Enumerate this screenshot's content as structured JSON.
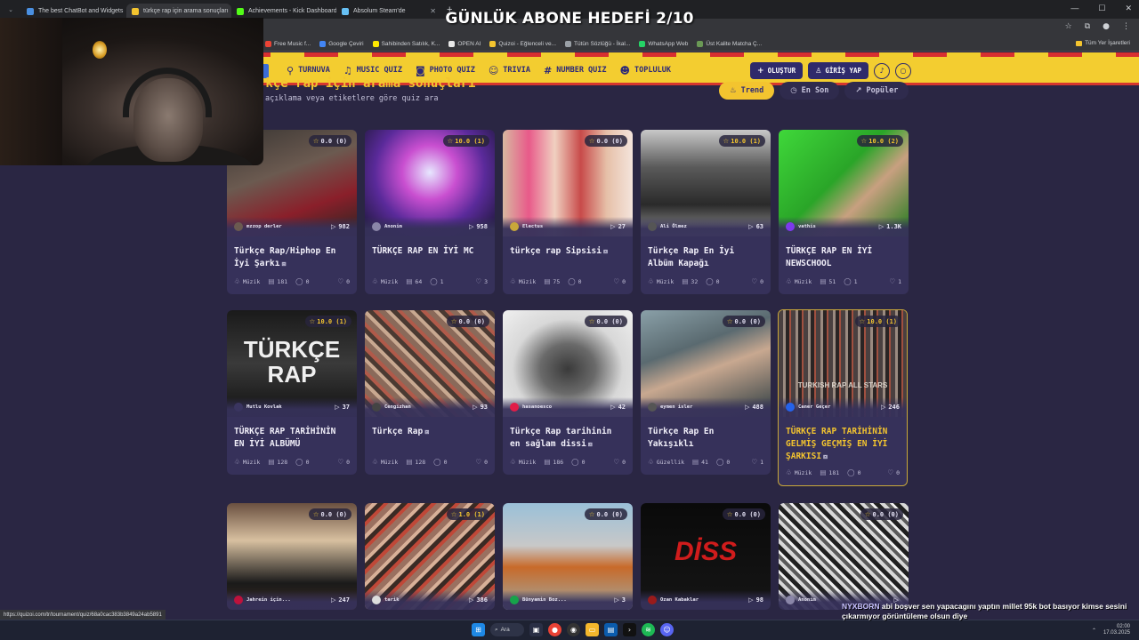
{
  "overlay": {
    "title": "GÜNLÜK ABONE HEDEFİ 2/10"
  },
  "browser": {
    "tabs": [
      {
        "label": "The best ChatBot and Widgets",
        "fav": "#4a90e2",
        "active": false
      },
      {
        "label": "türkçe rap için arama sonuçları",
        "fav": "#f3c42f",
        "active": true
      },
      {
        "label": "Achievements - Kick Dashboard",
        "fav": "#53fc18",
        "active": false
      },
      {
        "label": "Absolum Steam'de",
        "fav": "#66c0f4",
        "active": false
      }
    ],
    "bookmarks": [
      {
        "label": "Free Music f...",
        "color": "#ea4335"
      },
      {
        "label": "Google Çeviri",
        "color": "#4285f4"
      },
      {
        "label": "Sahibinden Satılık, K...",
        "color": "#ffe800"
      },
      {
        "label": "OPEN AI",
        "color": "#e8e8e8"
      },
      {
        "label": "Quizoi - Eğlenceli ve...",
        "color": "#f3c42f"
      },
      {
        "label": "Tütün Sözlüğü - İkal...",
        "color": "#9aa0a6"
      },
      {
        "label": "WhatsApp Web",
        "color": "#25d366"
      },
      {
        "label": "Üst Kalite Matcha Ç...",
        "color": "#6a9955"
      }
    ],
    "all_bookmarks": "Tüm Yer İşaretleri",
    "status_url": "https://quizoi.com/tr/tournament/quiz/68a0cac383b3849a24ab5891"
  },
  "nav": {
    "items": [
      {
        "label": "TURNUVA",
        "icon": "trophy-icon",
        "glyph": "⚲"
      },
      {
        "label": "MUSIC QUIZ",
        "icon": "music-icon",
        "glyph": "♫"
      },
      {
        "label": "PHOTO QUIZ",
        "icon": "camera-icon",
        "glyph": "◙"
      },
      {
        "label": "TRIVIA",
        "icon": "chat-icon",
        "glyph": "☺"
      },
      {
        "label": "NUMBER QUIZ",
        "icon": "hash-icon",
        "glyph": "#"
      },
      {
        "label": "TOPLULUK",
        "icon": "users-icon",
        "glyph": "☻"
      }
    ],
    "create": "OLUŞTUR",
    "login": "GİRİŞ YAP"
  },
  "page": {
    "heading": "rkçe rap için arama sonuçları",
    "subtitle": "açıklama veya etiketlere göre quiz ara",
    "sort_tabs": [
      {
        "label": "Trend",
        "icon": "flame-icon",
        "glyph": "♨",
        "active": true
      },
      {
        "label": "En Son",
        "icon": "clock-icon",
        "glyph": "◷",
        "active": false
      },
      {
        "label": "Popüler",
        "icon": "trend-icon",
        "glyph": "↗",
        "active": false
      }
    ]
  },
  "cards": [
    {
      "title": "Türkçe Rap/Hiphop En İyi Şarkı",
      "video": true,
      "rating": "0.0 (0)",
      "gold": false,
      "author": "mzzop derler",
      "plays": "982",
      "category": "Müzik",
      "questions": "181",
      "comments": "0",
      "likes": "0",
      "thumb": "linear-gradient(160deg,#3a3633 0%,#6b5a50 40%,#8a1f2a 70%,#2a2522 100%)",
      "avatar": "#6b5a50"
    },
    {
      "title": "TÜRKÇE RAP EN İYİ MC",
      "video": false,
      "rating": "10.0 (1)",
      "gold": true,
      "author": "Anonim",
      "plays": "958",
      "category": "Müzik",
      "questions": "64",
      "comments": "1",
      "likes": "3",
      "thumb": "radial-gradient(ellipse at 50% 40%,#e7e7ff 0%,#c94fd0 30%,#5a2a9a 60%,#17162e 100%)",
      "avatar": "#8a86a8"
    },
    {
      "title": "türkçe rap Sipsisi",
      "video": true,
      "rating": "0.0 (0)",
      "gold": false,
      "author": "Electus",
      "plays": "27",
      "category": "Müzik",
      "questions": "75",
      "comments": "0",
      "likes": "0",
      "thumb": "linear-gradient(90deg,#d8b8a0 0%,#e85a8a 20%,#f0d0c0 40%,#c84a4a 60%,#e6c0a8 80%,#f4e4dc 100%)",
      "avatar": "#c9a83a"
    },
    {
      "title": "Türkçe Rap En İyi Albüm Kapağı",
      "video": false,
      "rating": "10.0 (1)",
      "gold": true,
      "author": "Ali Ölmez",
      "plays": "63",
      "category": "Müzik",
      "questions": "32",
      "comments": "0",
      "likes": "0",
      "thumb": "linear-gradient(180deg,#c8c8c8 0%,#5a5a5a 35%,#2a2a2a 70%,#9a9a9a 100%)",
      "avatar": "#555"
    },
    {
      "title": "TÜRKÇE RAP EN İYİ NEWSCHOOL",
      "video": false,
      "rating": "10.0 (2)",
      "gold": true,
      "author": "vathis",
      "plays": "1.3K",
      "category": "Müzik",
      "questions": "51",
      "comments": "1",
      "likes": "1",
      "thumb": "linear-gradient(135deg,#3fd83a 0%,#2aa528 45%,#c8a080 65%,#1f7a1c 100%)",
      "avatar": "#7c3aed"
    },
    {
      "title": "TÜRKÇE RAP TARİHİNİN EN İYİ ALBÜMÜ",
      "video": false,
      "rating": "10.0 (1)",
      "gold": true,
      "author": "Mutlu Kovlak",
      "plays": "37",
      "category": "Müzik",
      "questions": "128",
      "comments": "0",
      "likes": "0",
      "thumb": "linear-gradient(180deg,#1a1a1a 0%,#3a3a3a 50%,#101010 100%)",
      "avatar": "#3a3560",
      "overlay": [
        "TÜRKÇE",
        "RAP"
      ]
    },
    {
      "title": "Türkçe Rap",
      "video": true,
      "rating": "0.0 (0)",
      "gold": false,
      "author": "Cengizhan",
      "plays": "93",
      "category": "Müzik",
      "questions": "128",
      "comments": "0",
      "likes": "0",
      "thumb": "repeating-linear-gradient(45deg,#8a6a5a 0 6px,#c8a890 6px 10px,#4a3a32 10px 15px,#b05a4a 15px 19px)",
      "avatar": "#444"
    },
    {
      "title": "Türkçe Rap tarihinin en sağlam dissi",
      "video": true,
      "rating": "0.0 (0)",
      "gold": false,
      "author": "hasanoesco",
      "plays": "42",
      "category": "Müzik",
      "questions": "186",
      "comments": "0",
      "likes": "0",
      "thumb": "radial-gradient(ellipse at 50% 55%,#3a3a3a 0%,#6a6a6a 30%,#d8d8d8 60%,#f0f0f0 100%)",
      "avatar": "#e11d48"
    },
    {
      "title": "Türkçe Rap En Yakışıklı",
      "video": false,
      "rating": "0.0 (0)",
      "gold": false,
      "author": "eymen isler",
      "plays": "488",
      "category": "Güzellik",
      "questions": "41",
      "comments": "0",
      "likes": "1",
      "thumb": "linear-gradient(160deg,#8aa0a8 0%,#5a6a70 35%,#c8a890 55%,#2a3a40 100%)",
      "avatar": "#555"
    },
    {
      "title": "TÜRKÇE RAP TARİHİNİN GELMİŞ GEÇMİŞ EN İYİ ŞARKISI",
      "video": true,
      "rating": "10.0 (1)",
      "gold": true,
      "author": "Caner Geçer",
      "plays": "246",
      "category": "Müzik",
      "questions": "181",
      "comments": "0",
      "likes": "0",
      "thumb": "repeating-linear-gradient(90deg,#4a4040 0 5px,#9a8a80 5px 8px,#2a2424 8px 12px,#a05040 12px 14px)",
      "avatar": "#2563eb",
      "highlight": true,
      "overlay": [
        "TURKISH RAP ALL STARS"
      ]
    },
    {
      "title": "",
      "video": false,
      "rating": "0.0 (0)",
      "gold": false,
      "author": "Jahrein için...",
      "plays": "247",
      "category": "",
      "questions": "",
      "comments": "",
      "likes": "",
      "thumb": "linear-gradient(180deg,#6a5040 0%,#d8c0a0 35%,#1a1a1a 75%,#3a2a20 100%)",
      "avatar": "#be123c"
    },
    {
      "title": "",
      "video": false,
      "rating": "1.0 (1)",
      "gold": true,
      "author": "tarik",
      "plays": "386",
      "category": "",
      "questions": "",
      "comments": "",
      "likes": "",
      "thumb": "repeating-linear-gradient(135deg,#9a7060 0 6px,#d8b098 6px 10px,#3a2a24 10px 15px,#c04838 15px 19px)",
      "avatar": "#ddd"
    },
    {
      "title": "",
      "video": false,
      "rating": "0.0 (0)",
      "gold": false,
      "author": "Bünyamin Boz...",
      "plays": "3",
      "category": "",
      "questions": "",
      "comments": "",
      "likes": "",
      "thumb": "linear-gradient(180deg,#9ac0d8 0%,#c8c8c8 40%,#c86a2a 60%,#a0a8a0 100%)",
      "avatar": "#16a34a"
    },
    {
      "title": "",
      "video": false,
      "rating": "0.0 (0)",
      "gold": false,
      "author": "Ozan Kabaklar",
      "plays": "98",
      "category": "",
      "questions": "",
      "comments": "",
      "likes": "",
      "thumb": "linear-gradient(180deg,#0a0a0a 0%,#151515 100%)",
      "avatar": "#991b1b",
      "overlay": [
        "DİSS"
      ]
    },
    {
      "title": "",
      "video": false,
      "rating": "0.0 (0)",
      "gold": false,
      "author": "Anonim",
      "plays": "",
      "category": "",
      "questions": "",
      "comments": "",
      "likes": "",
      "thumb": "repeating-linear-gradient(45deg,#202020 0 5px,#d8d8d8 5px 9px,#5a5a5a 9px 13px,#f0f0f0 13px 16px)",
      "avatar": "#8a86a8"
    }
  ],
  "chat": {
    "user": "NYXBORN",
    "message": "abi boşver sen yapacagını yaptın millet 95k bot basıyor kimse sesini çıkarmıyor görüntüleme olsun diye"
  },
  "taskbar": {
    "search": "Ara",
    "time": "02:00",
    "date": "17.03.2025"
  }
}
